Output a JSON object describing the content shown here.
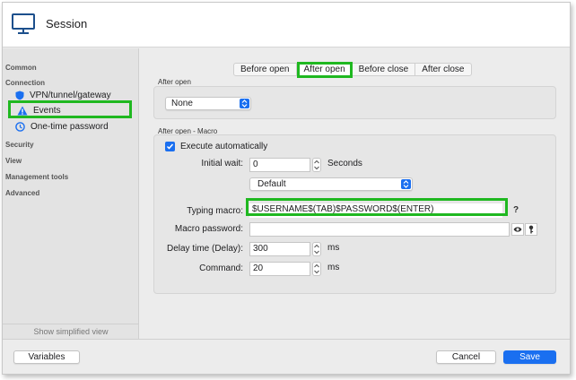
{
  "window": {
    "title": "Session"
  },
  "sidebar": {
    "categories": {
      "common": "Common",
      "connection": "Connection",
      "security": "Security",
      "view": "View",
      "management": "Management tools",
      "advanced": "Advanced"
    },
    "items": [
      {
        "label": "VPN/tunnel/gateway",
        "icon": "shield-icon"
      },
      {
        "label": "Events",
        "icon": "warning-icon"
      },
      {
        "label": "One-time password",
        "icon": "clock-icon"
      }
    ],
    "footer": "Show simplified view"
  },
  "tabs": [
    "Before open",
    "After open",
    "Before close",
    "After close"
  ],
  "after_open": {
    "group_label": "After open",
    "select_value": "None"
  },
  "macro": {
    "group_label": "After open - Macro",
    "execute_label": "Execute automatically",
    "initial_wait_label": "Initial wait:",
    "initial_wait_value": "0",
    "initial_wait_unit": "Seconds",
    "mode_select": "Default",
    "typing_label": "Typing macro:",
    "typing_value": "$USERNAME$(TAB)$PASSWORD$(ENTER)",
    "help": "?",
    "password_label": "Macro password:",
    "password_value": "",
    "delay_label": "Delay time (Delay):",
    "delay_value": "300",
    "delay_unit": "ms",
    "command_label": "Command:",
    "command_value": "20",
    "command_unit": "ms"
  },
  "footer": {
    "variables": "Variables",
    "cancel": "Cancel",
    "save": "Save"
  },
  "colors": {
    "accent": "#1a6ff0",
    "highlight": "#1fb820"
  }
}
